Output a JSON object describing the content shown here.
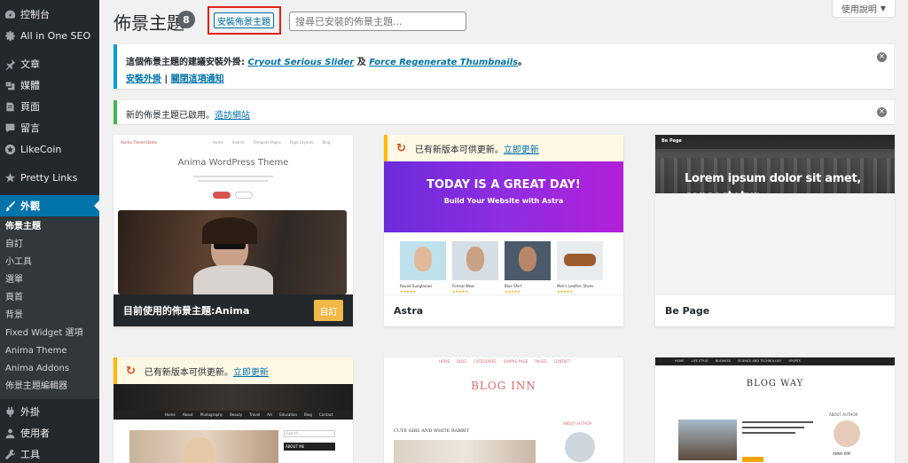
{
  "sidebar": {
    "items": [
      {
        "label": "控制台",
        "icon": "dashboard-icon"
      },
      {
        "label": "All in One SEO",
        "icon": "gear-icon"
      },
      {
        "label": "文章",
        "icon": "pin-icon"
      },
      {
        "label": "媒體",
        "icon": "media-icon"
      },
      {
        "label": "頁面",
        "icon": "page-icon"
      },
      {
        "label": "留言",
        "icon": "comment-icon"
      },
      {
        "label": "LikeCoin",
        "icon": "likecoin-icon"
      },
      {
        "label": "Pretty Links",
        "icon": "star-icon"
      },
      {
        "label": "外觀",
        "icon": "brush-icon"
      }
    ],
    "submenu": [
      {
        "label": "佈景主題",
        "current": true
      },
      {
        "label": "自訂"
      },
      {
        "label": "小工具"
      },
      {
        "label": "選單"
      },
      {
        "label": "頁首"
      },
      {
        "label": "背景"
      },
      {
        "label": "Fixed Widget 選項"
      },
      {
        "label": "Anima Theme"
      },
      {
        "label": "Anima Addons"
      },
      {
        "label": "佈景主題編輯器"
      }
    ],
    "bottom_items": [
      {
        "label": "外掛",
        "icon": "plugin-icon"
      },
      {
        "label": "使用者",
        "icon": "user-icon"
      },
      {
        "label": "工具",
        "icon": "tools-icon"
      }
    ]
  },
  "header": {
    "title": "佈景主題",
    "count": "8",
    "add_new": "安裝佈景主題",
    "search_placeholder": "搜尋已安裝的佈景主題...",
    "help": "使用說明"
  },
  "notices": {
    "plugins": {
      "prefix": "這個佈景主題的建議安裝外掛: ",
      "plugin1": "Cryout Serious Slider",
      "and": " 及 ",
      "plugin2": "Force Regenerate Thumbnails",
      "suffix": "。",
      "install": "安裝外掛",
      "sep": " | ",
      "dismiss": "關閉這項通知"
    },
    "activated": {
      "text": "新的佈景主題已啟用。",
      "link": "造訪網站"
    }
  },
  "themes": {
    "anima": {
      "name_prefix": "目前使用的佈景主題: ",
      "name": "Anima",
      "customize": "自訂",
      "shot_logo": "Anima Theme Demo",
      "shot_title": "Anima WordPress Theme",
      "shot_nav": [
        "Home",
        "Search",
        "Template Pages",
        "Page Layouts",
        "Blog"
      ]
    },
    "astra": {
      "name": "Astra",
      "update_text": "已有新版本可供更新。",
      "update_link": "立即更新",
      "hero_title": "TODAY IS A GREAT DAY!",
      "hero_sub": "Build Your Website with Astra",
      "products": [
        "Round Sunglasses",
        "Formal Wear",
        "Blue Shirt",
        "Men's Leather Shoes"
      ]
    },
    "bepage": {
      "name": "Be Page",
      "logo": "Be Page",
      "hero_text": "Lorem ipsum dolor sit amet, consectetur"
    },
    "fourth": {
      "update_text": "已有新版本可供更新。",
      "update_link": "立即更新",
      "nav": [
        "Home",
        "About",
        "Photography",
        "Beauty",
        "Travel",
        "Art",
        "Education",
        "Blog",
        "Contact"
      ],
      "search": "Search ...",
      "about": "ABOUT ME"
    },
    "bloginn": {
      "title": "BLOG INN",
      "nav": [
        "HOME",
        "BLOG",
        "CATEGORIES",
        "SAMPLE PAGE",
        "PAGES",
        "CONTACT"
      ],
      "post_title": "CUTE GIRL AND WHITE RABBIT",
      "about": "ABOUT AUTHOR"
    },
    "blogway": {
      "title": "BLOG WAY",
      "nav": [
        "HOME",
        "LIFE STYLE",
        "BUSINESS",
        "SCIENCE AND TECHNOLOGY",
        "SPORTS"
      ],
      "about": "ABOUT AUTHOR",
      "author": "ANNA KIM"
    }
  }
}
